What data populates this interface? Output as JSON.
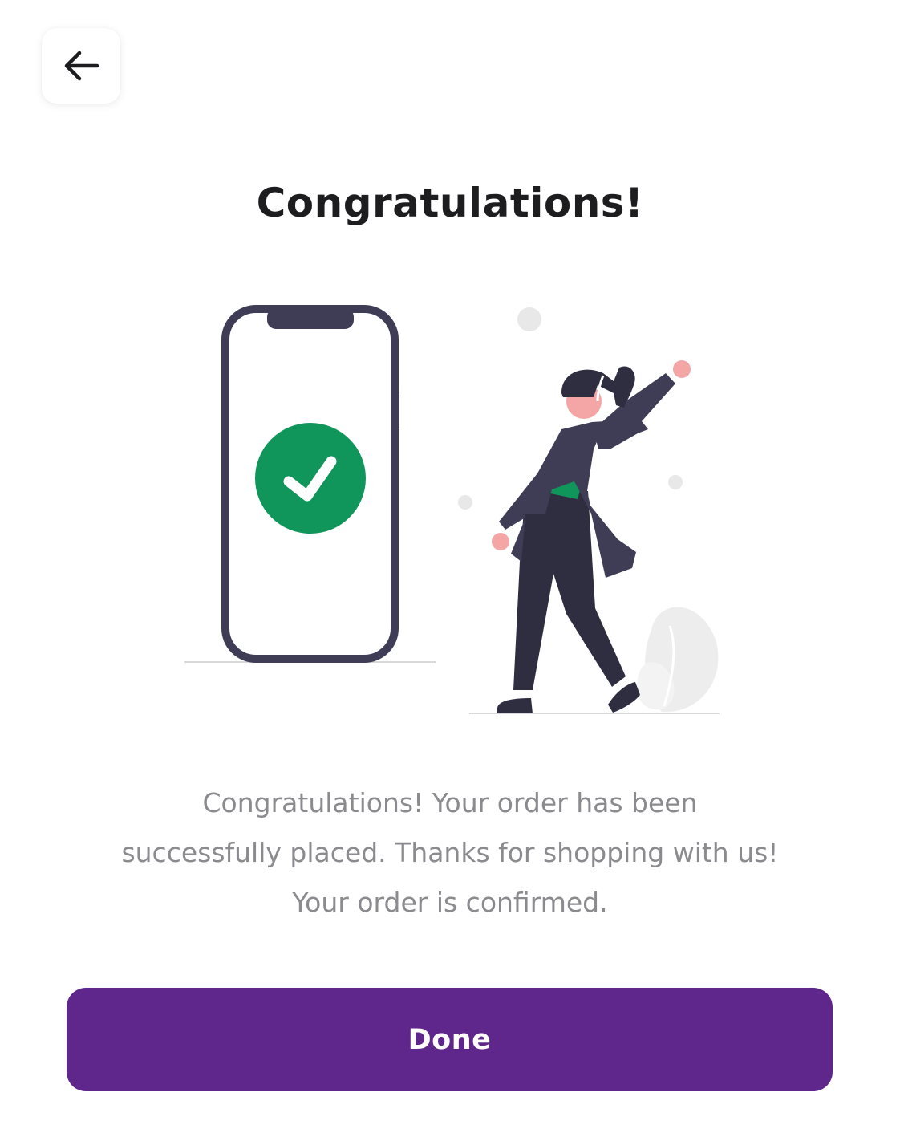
{
  "header": {
    "back_icon": "arrow-left-icon"
  },
  "main": {
    "title": "Congratulations!",
    "message": "Congratulations! Your order has been successfully placed. Thanks for shopping with us! Your order is confirmed.",
    "illustration": {
      "check_icon": "check-circle-icon"
    }
  },
  "footer": {
    "done_label": "Done"
  },
  "colors": {
    "accent": "#5f278c",
    "success": "#10955a",
    "ink": "#3f3d56",
    "skin": "#f4a6a6",
    "muted_text": "#8b8b8f"
  }
}
